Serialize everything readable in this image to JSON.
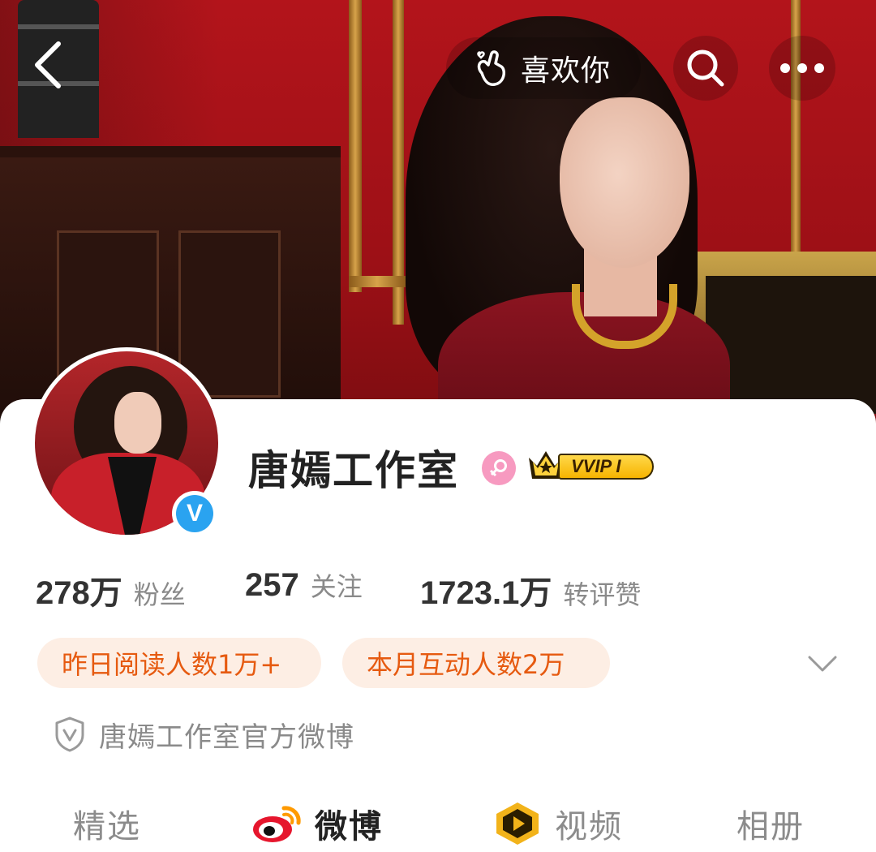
{
  "nav": {
    "like_label": "喜欢你"
  },
  "profile": {
    "name": "唐嫣工作室",
    "vip_badge": "VVIP I",
    "verified_mark": "V",
    "verification_text": "唐嫣工作室官方微博"
  },
  "stats": [
    {
      "value": "278万",
      "label": "粉丝"
    },
    {
      "value": "257",
      "label": "关注"
    },
    {
      "value": "1723.1万",
      "label": "转评赞"
    }
  ],
  "pills": [
    {
      "text": "昨日阅读人数1万+"
    },
    {
      "text": "本月互动人数2万"
    }
  ],
  "tabs": [
    {
      "label": "精选",
      "icon": null,
      "active": false
    },
    {
      "label": "微博",
      "icon": "weibo-logo-icon",
      "active": true
    },
    {
      "label": "视频",
      "icon": "video-play-icon",
      "active": false
    },
    {
      "label": "相册",
      "icon": null,
      "active": false
    }
  ],
  "colors": {
    "pill_bg": "#fdeee4",
    "pill_text": "#e65a10",
    "verified_blue": "#2aa3f0",
    "gender_pink": "#f79ac0",
    "vip_gold": "#f6b400"
  }
}
